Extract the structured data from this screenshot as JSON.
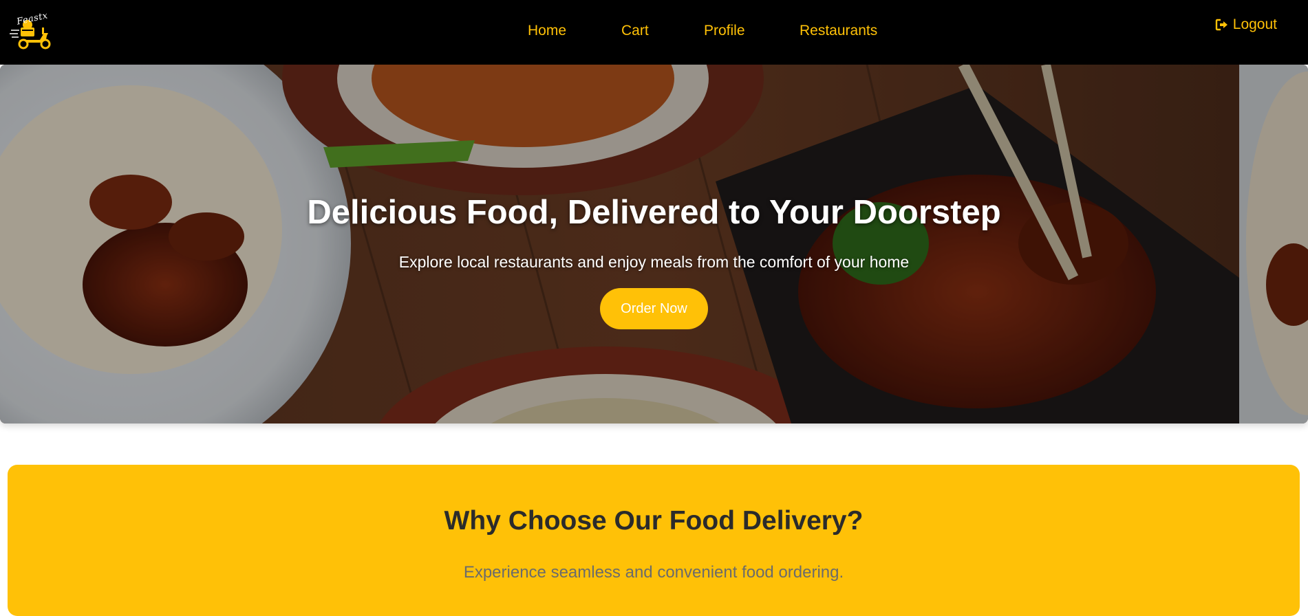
{
  "brand": {
    "logo_text": "Feastx",
    "accent_color": "#ffc107"
  },
  "nav": {
    "links": [
      {
        "label": "Home"
      },
      {
        "label": "Cart"
      },
      {
        "label": "Profile"
      },
      {
        "label": "Restaurants"
      }
    ],
    "logout": {
      "label": "Logout",
      "icon": "logout-icon"
    }
  },
  "hero": {
    "title": "Delicious Food, Delivered to Your Doorstep",
    "subtitle": "Explore local restaurants and enjoy meals from the comfort of your home",
    "cta_label": "Order Now"
  },
  "why": {
    "title": "Why Choose Our Food Delivery?",
    "subtitle": "Experience seamless and convenient food ordering."
  }
}
